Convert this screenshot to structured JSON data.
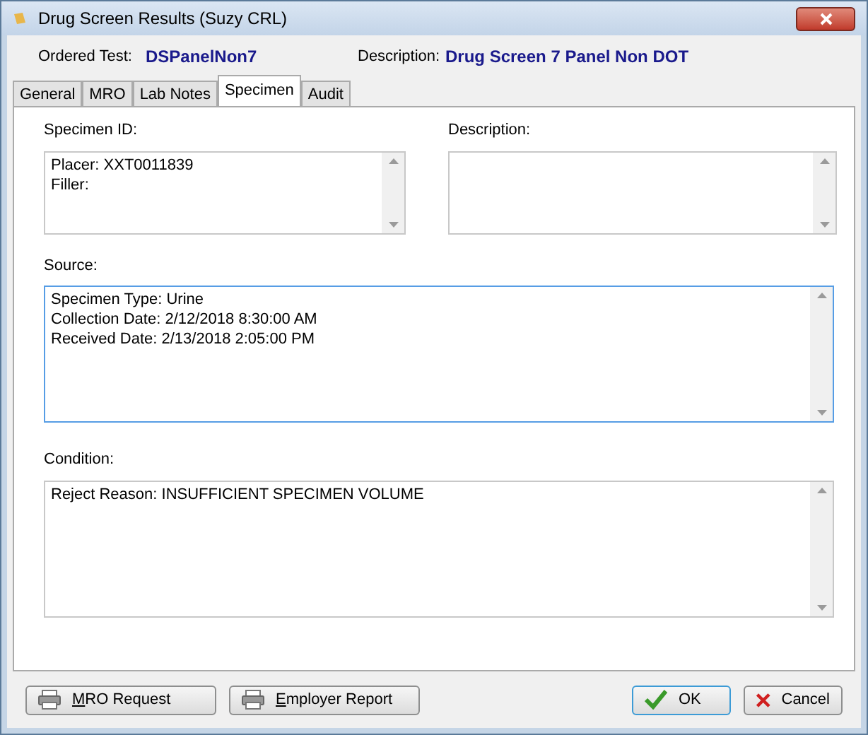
{
  "window": {
    "title": "Drug Screen Results (Suzy CRL)"
  },
  "header": [
    {
      "label": "Ordered Test:",
      "value": "DSPanelNon7"
    },
    {
      "label": "Description:",
      "value": "Drug Screen 7 Panel Non DOT"
    }
  ],
  "tabs": [
    {
      "label": "General",
      "selected": false
    },
    {
      "label": "MRO",
      "selected": false
    },
    {
      "label": "Lab Notes",
      "selected": false
    },
    {
      "label": "Specimen",
      "selected": true
    },
    {
      "label": "Audit",
      "selected": false
    }
  ],
  "specimen_id": {
    "label": "Specimen ID:",
    "lines": [
      "Placer: XXT0011839",
      "Filler:"
    ]
  },
  "description": {
    "label": "Description:"
  },
  "source": {
    "label": "Source:",
    "focused": true,
    "lines": [
      "Specimen Type: Urine",
      "Collection Date: 2/12/2018 8:30:00 AM",
      "Received Date: 2/13/2018 2:05:00 PM"
    ]
  },
  "condition": {
    "label": "Condition:",
    "lines": [
      "Reject Reason: INSUFFICIENT SPECIMEN VOLUME"
    ]
  },
  "buttons": [
    {
      "kind": "print",
      "mnemonic": "M",
      "rest": "RO Request"
    },
    {
      "kind": "print",
      "mnemonic": "E",
      "rest": "mployer Report"
    },
    {
      "kind": "ok",
      "label": "OK"
    },
    {
      "kind": "cancel",
      "label": "Cancel"
    }
  ]
}
